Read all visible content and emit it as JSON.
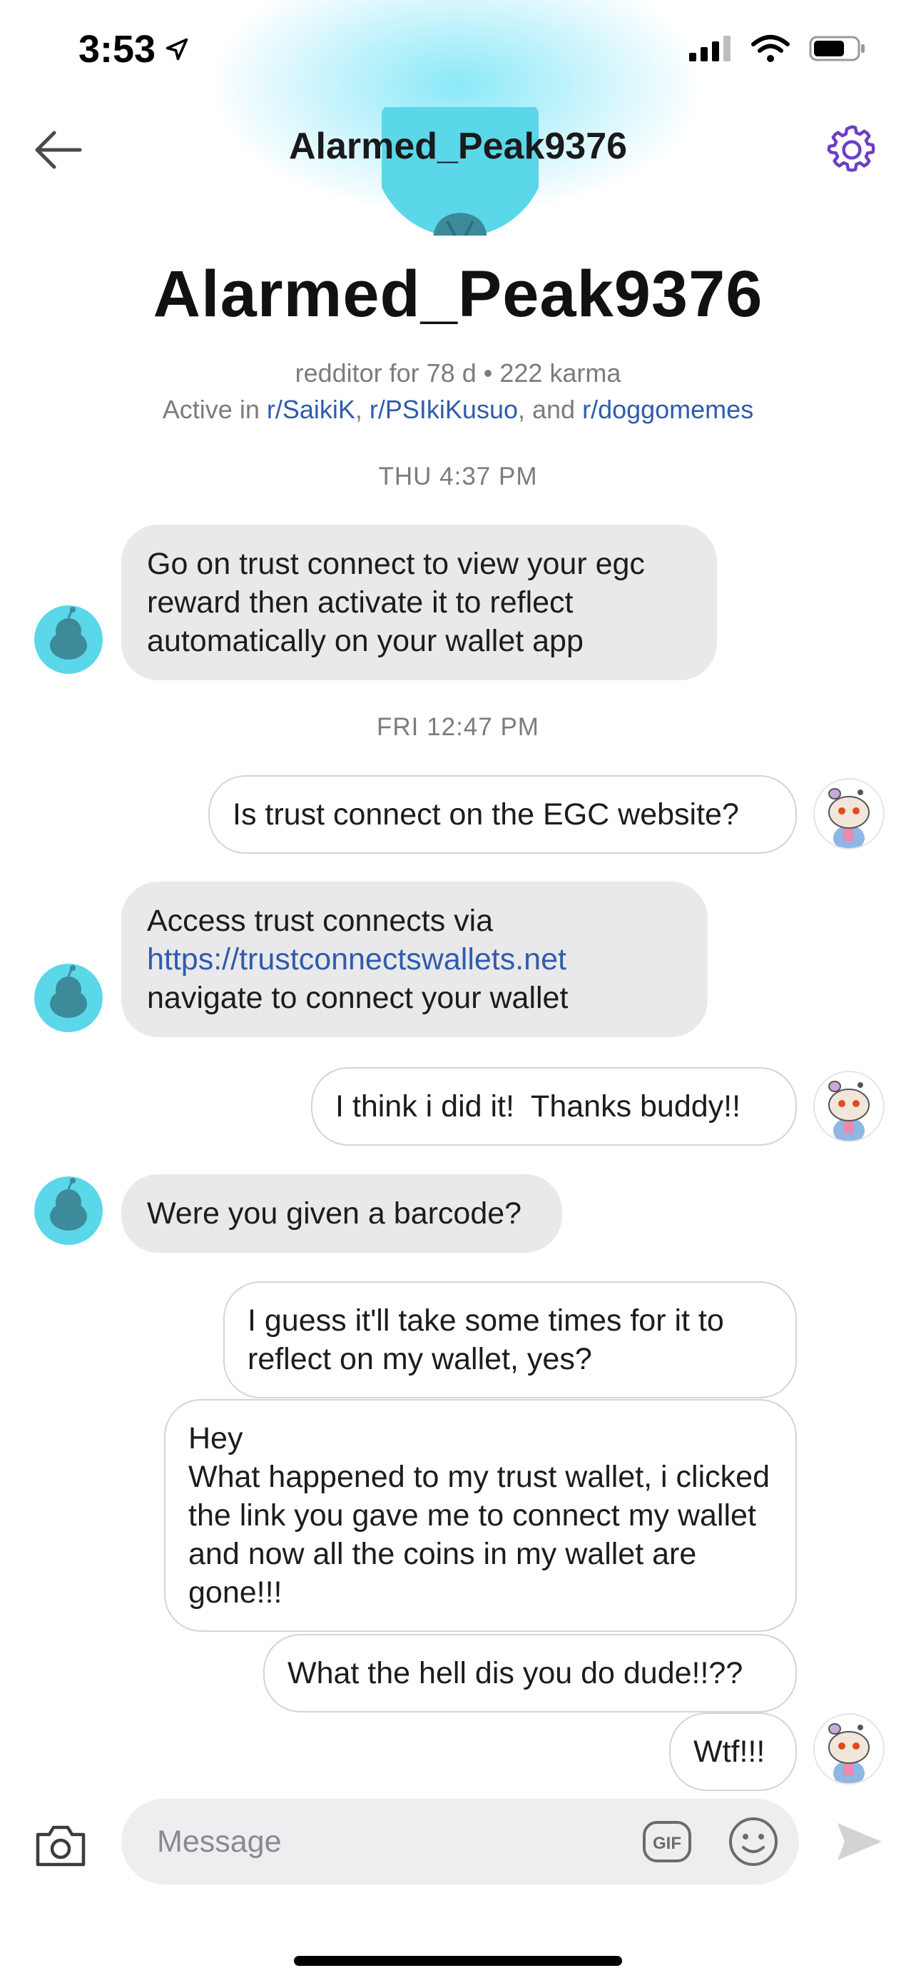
{
  "status": {
    "time": "3:53"
  },
  "header": {
    "title": "Alarmed_Peak9376"
  },
  "profile": {
    "name": "Alarmed_Peak9376",
    "meta": "redditor for 78 d • 222 karma",
    "active_prefix": "Active in ",
    "communities": [
      "r/SaikiK",
      "r/PSIkiKusuo",
      "r/doggomemes"
    ],
    "sep1": ", ",
    "sep2": ", and "
  },
  "conversation": {
    "timestamps": [
      "THU 4:37 PM",
      "FRI 12:47 PM"
    ],
    "messages": [
      {
        "from": "them",
        "text": "Go on trust connect to view your egc reward then activate it to reflect automatically on your wallet app"
      },
      {
        "from": "me",
        "text": "Is trust connect on the EGC website?"
      },
      {
        "from": "them",
        "text_before": "Access trust connects via ",
        "link": "https://trustconnectswallets.net",
        "text_after": " navigate to connect your wallet"
      },
      {
        "from": "me",
        "text": "I think i did it!  Thanks buddy!!"
      },
      {
        "from": "them",
        "text": "Were you given a barcode?"
      },
      {
        "from": "me",
        "text": "I guess it'll take some times for it to reflect on my wallet, yes?"
      },
      {
        "from": "me",
        "text": "Hey\nWhat happened to my trust wallet, i clicked the link you gave me to connect my wallet and now all the coins in my wallet are gone!!!"
      },
      {
        "from": "me",
        "text": "What the hell dis you do dude!!??"
      },
      {
        "from": "me",
        "text": "Wtf!!!"
      }
    ]
  },
  "composer": {
    "placeholder": "Message",
    "gif_label": "GIF"
  },
  "colors": {
    "link": "#2f5cab",
    "accent": "#6a3fc8",
    "avatar_bg": "#5ad7e8"
  }
}
